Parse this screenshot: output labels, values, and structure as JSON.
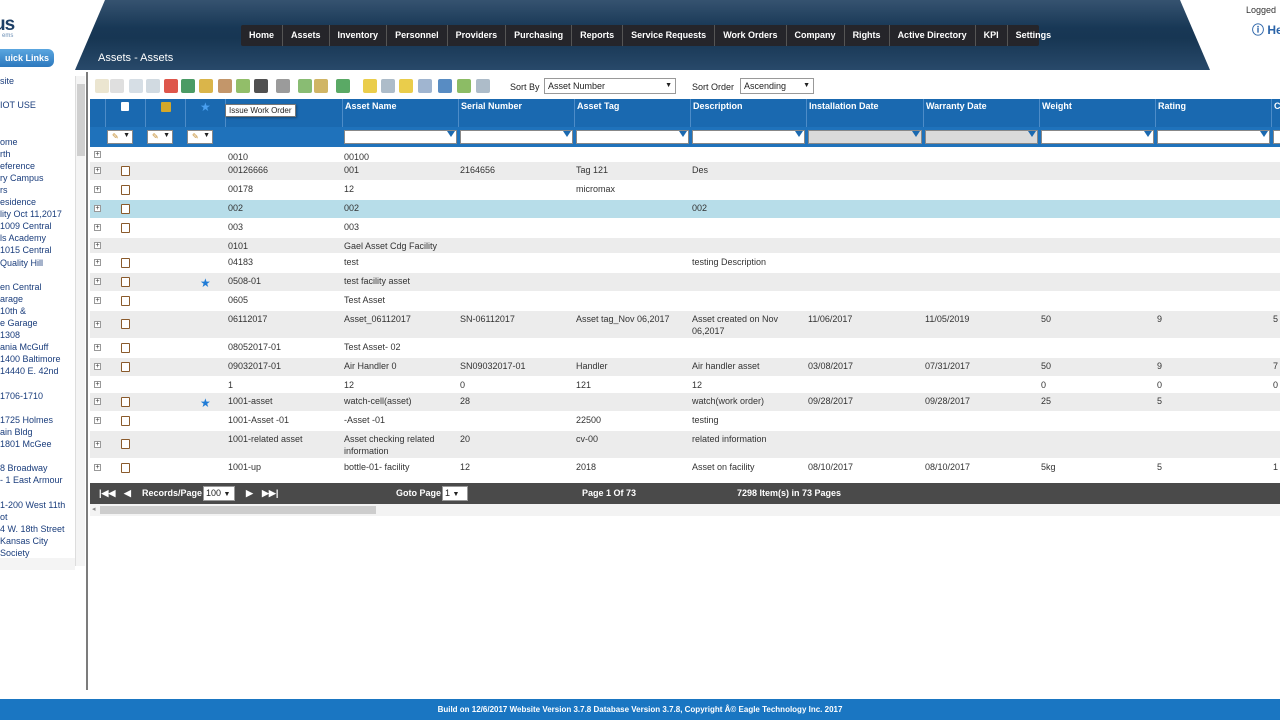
{
  "header": {
    "logo_text": "us",
    "logo_sub": "ems",
    "quick_links": "uick Links",
    "page_title": "Assets - Assets",
    "logged": "Logged",
    "hello": "Hel",
    "nav": [
      "Home",
      "Assets",
      "Inventory",
      "Personnel",
      "Providers",
      "Purchasing",
      "Reports",
      "Service Requests",
      "Work Orders",
      "Company",
      "Rights",
      "Active Directory",
      "KPI",
      "Settings"
    ]
  },
  "left_tree": [
    "site",
    "",
    "IOT USE",
    "",
    "",
    "ome",
    "rth",
    "eference",
    "ry Campus",
    "rs",
    "esidence",
    "lity Oct 11,2017",
    "1009 Central",
    "ls Academy",
    "1015 Central",
    "Quality Hill",
    "",
    "en Central",
    "arage",
    "10th &",
    "e Garage",
    "1308",
    "ania McGuff",
    "1400 Baltimore",
    "14440 E. 42nd",
    "",
    "1706-1710",
    "",
    "1725 Holmes",
    "ain Bldg",
    "1801 McGee",
    "",
    "8 Broadway",
    "- 1 East Armour",
    "",
    "1-200 West 11th",
    "ot",
    "4 W. 18th Street",
    "Kansas City",
    "Society"
  ],
  "toolbar": {
    "sort_by_label": "Sort By",
    "sort_by_value": "Asset Number",
    "sort_order_label": "Sort Order",
    "sort_order_value": "Ascending",
    "tooltip": "Issue Work Order"
  },
  "columns": [
    "Asset Name",
    "Serial Number",
    "Asset Tag",
    "Description",
    "Installation Date",
    "Warranty Date",
    "Weight",
    "Rating",
    "C"
  ],
  "rows": [
    {
      "num": "0010",
      "name": "00100",
      "serial": "",
      "tag": "",
      "desc": "",
      "inst": "",
      "warr": "",
      "weight": "",
      "rating": "",
      "c": "",
      "book": false,
      "star": false
    },
    {
      "num": "00126666",
      "name": "001",
      "serial": "2164656",
      "tag": "Tag 121",
      "desc": "Des",
      "inst": "",
      "warr": "",
      "weight": "",
      "rating": "",
      "c": "",
      "book": true,
      "star": false
    },
    {
      "num": "00178",
      "name": "12",
      "serial": "",
      "tag": "micromax",
      "desc": "",
      "inst": "",
      "warr": "",
      "weight": "",
      "rating": "",
      "c": "",
      "book": true,
      "star": false
    },
    {
      "num": "002",
      "name": "002",
      "serial": "",
      "tag": "",
      "desc": "002",
      "inst": "",
      "warr": "",
      "weight": "",
      "rating": "",
      "c": "",
      "book": true,
      "star": false
    },
    {
      "num": "003",
      "name": "003",
      "serial": "",
      "tag": "",
      "desc": "",
      "inst": "",
      "warr": "",
      "weight": "",
      "rating": "",
      "c": "",
      "book": true,
      "star": false
    },
    {
      "num": "0101",
      "name": "Gael Asset Cdg Facility",
      "serial": "",
      "tag": "",
      "desc": "",
      "inst": "",
      "warr": "",
      "weight": "",
      "rating": "",
      "c": "",
      "book": false,
      "star": false
    },
    {
      "num": "04183",
      "name": "test",
      "serial": "",
      "tag": "",
      "desc": "testing Description",
      "inst": "",
      "warr": "",
      "weight": "",
      "rating": "",
      "c": "",
      "book": true,
      "star": false
    },
    {
      "num": "0508-01",
      "name": "test facility asset",
      "serial": "",
      "tag": "",
      "desc": "",
      "inst": "",
      "warr": "",
      "weight": "",
      "rating": "",
      "c": "",
      "book": true,
      "star": true
    },
    {
      "num": "0605",
      "name": "Test Asset",
      "serial": "",
      "tag": "",
      "desc": "",
      "inst": "",
      "warr": "",
      "weight": "",
      "rating": "",
      "c": "",
      "book": true,
      "star": false
    },
    {
      "num": "06112017",
      "name": "Asset_06112017",
      "serial": "SN-06112017",
      "tag": "Asset tag_Nov 06,2017",
      "desc": "Asset created on Nov 06,2017",
      "inst": "11/06/2017",
      "warr": "11/05/2019",
      "weight": "50",
      "rating": "9",
      "c": "5",
      "book": true,
      "star": false
    },
    {
      "num": "08052017-01",
      "name": "Test Asset- 02",
      "serial": "",
      "tag": "",
      "desc": "",
      "inst": "",
      "warr": "",
      "weight": "",
      "rating": "",
      "c": "",
      "book": true,
      "star": false
    },
    {
      "num": "09032017-01",
      "name": "Air Handler 0",
      "serial": "SN09032017-01",
      "tag": "Handler",
      "desc": "Air handler asset",
      "inst": "03/08/2017",
      "warr": "07/31/2017",
      "weight": "50",
      "rating": "9",
      "c": "7",
      "book": true,
      "star": false
    },
    {
      "num": "1",
      "name": "12",
      "serial": "0",
      "tag": "121",
      "desc": "12",
      "inst": "",
      "warr": "",
      "weight": "0",
      "rating": "0",
      "c": "0",
      "book": false,
      "star": false
    },
    {
      "num": "1001-asset",
      "name": "watch-cell(asset)",
      "serial": "28",
      "tag": "",
      "desc": "watch(work order)",
      "inst": "09/28/2017",
      "warr": "09/28/2017",
      "weight": "25",
      "rating": "5",
      "c": "",
      "book": true,
      "star": true
    },
    {
      "num": "1001-Asset -01",
      "name": "-Asset -01",
      "serial": "",
      "tag": "22500",
      "desc": "testing",
      "inst": "",
      "warr": "",
      "weight": "",
      "rating": "",
      "c": "",
      "book": true,
      "star": false
    },
    {
      "num": "1001-related asset",
      "name": "Asset checking related information",
      "serial": "20",
      "tag": "cv-00",
      "desc": "related information",
      "inst": "",
      "warr": "",
      "weight": "",
      "rating": "",
      "c": "",
      "book": true,
      "star": false
    },
    {
      "num": "1001-up",
      "name": "bottle-01- facility",
      "serial": "12",
      "tag": "2018",
      "desc": "Asset on facility",
      "inst": "08/10/2017",
      "warr": "08/10/2017",
      "weight": "5kg",
      "rating": "5",
      "c": "1",
      "book": true,
      "star": false
    }
  ],
  "pager": {
    "records_label": "Records/Page",
    "records_value": "100",
    "goto_label": "Goto Page",
    "goto_value": "1",
    "page_info": "Page 1 Of 73",
    "items_info": "7298 Item(s) in 73 Pages"
  },
  "footer": "Build on 12/6/2017 Website Version 3.7.8 Database Version 3.7.8, Copyright Â© Eagle Technology Inc. 2017",
  "colors": {
    "grid_header": "#1a69b0",
    "selected_row": "#b7dde9",
    "footer": "#1a76c2",
    "nav_bg": "#25252a"
  }
}
